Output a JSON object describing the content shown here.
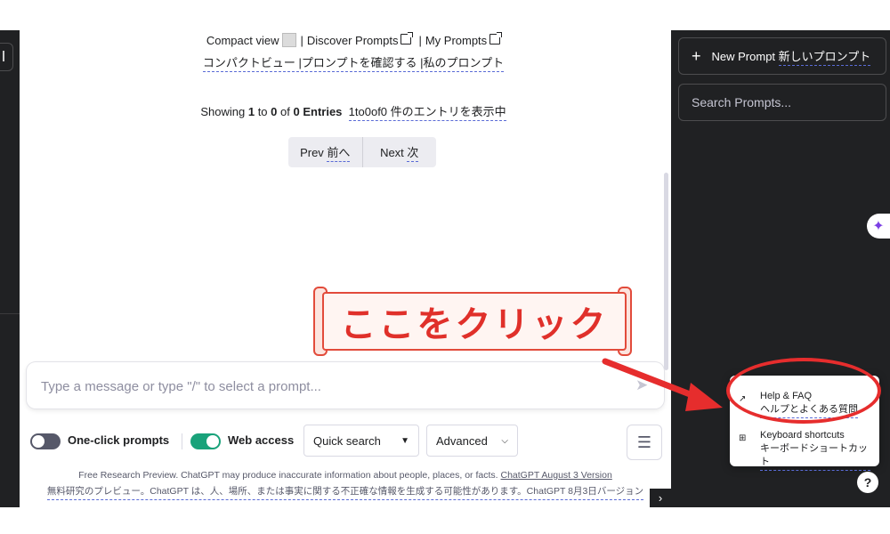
{
  "main": {
    "compact_view": "Compact view",
    "discover_prompts": "Discover Prompts",
    "my_prompts": "My Prompts",
    "sep": "|",
    "jp_links": "コンパクトビュー |プロンプトを確認する |私のプロンプト",
    "showing": {
      "prefix": "Showing",
      "from": "1",
      "to_word": "to",
      "to": "0",
      "of_word": "of",
      "total": "0",
      "entries": "Entries",
      "jp": "1to0of0 件のエントリを表示中"
    },
    "pager": {
      "prev": "Prev",
      "prev_jp": "前へ",
      "next": "Next",
      "next_jp": "次"
    },
    "composer": {
      "placeholder": "Type a message or type \"/\" to select a prompt..."
    },
    "controls": {
      "one_click": "One-click prompts",
      "web_access": "Web access",
      "quick_search": "Quick search",
      "advanced": "Advanced"
    },
    "disclaimer": {
      "en": "Free Research Preview. ChatGPT may produce inaccurate information about people, places, or facts.",
      "en_link": "ChatGPT August 3 Version",
      "jp": "無料研究のプレビュー。ChatGPT は、人、場所、または事実に関する不正確な情報を生成する可能性があります。ChatGPT 8月3日バージョン"
    }
  },
  "annotation": {
    "banner_text": "ここをクリック",
    "color": "#e62d2d"
  },
  "sidebar": {
    "new_prompt": "New Prompt",
    "new_prompt_jp": "新しいプロンプト",
    "search_placeholder": "Search Prompts...",
    "menu": [
      {
        "label": "Help & FAQ",
        "label_jp": "ヘルプとよくある質問",
        "icon": "external-link-icon"
      },
      {
        "label": "Keyboard shortcuts",
        "label_jp": "キーボードショートカット",
        "icon": "grid-icon"
      }
    ],
    "help_icon": "?"
  },
  "colors": {
    "sidebar_bg": "#202123",
    "toggle_on": "#19a27a",
    "toggle_off": "#565869"
  }
}
